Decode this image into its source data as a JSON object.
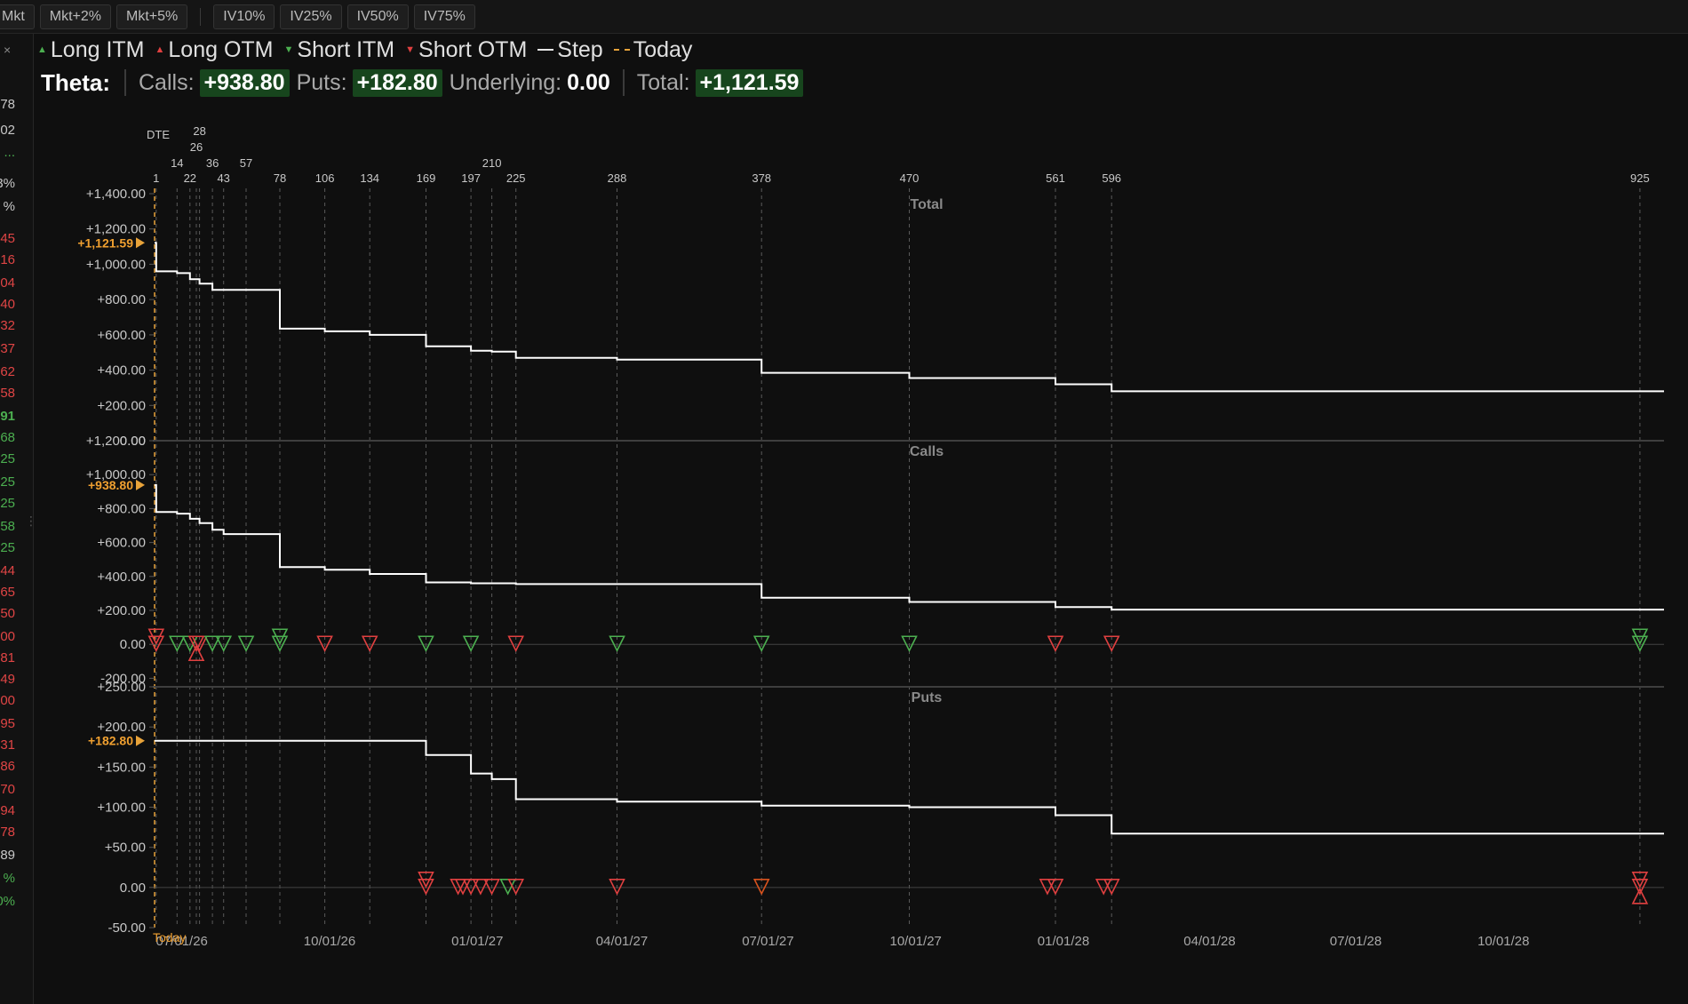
{
  "toolbar": {
    "buttons_left": [
      "Mkt",
      "Mkt+2%",
      "Mkt+5%"
    ],
    "buttons_right": [
      "IV10%",
      "IV25%",
      "IV50%",
      "IV75%"
    ]
  },
  "sidebar": {
    "close_glyph": "×",
    "handle_glyph": "⋮",
    "values": [
      {
        "text": "78",
        "color": "#c8c8c8"
      },
      {
        "text": "02",
        "color": "#c8c8c8"
      },
      {
        "text": "...",
        "color": "#4caf50"
      },
      {
        "text": "3%",
        "color": "#c8c8c8"
      },
      {
        "text": "%",
        "color": "#c8c8c8"
      },
      {
        "text": "45",
        "color": "#e04545"
      },
      {
        "text": "16",
        "color": "#e04545"
      },
      {
        "text": "04",
        "color": "#e04545"
      },
      {
        "text": "40",
        "color": "#e04545"
      },
      {
        "text": "32",
        "color": "#e04545"
      },
      {
        "text": "37",
        "color": "#e04545"
      },
      {
        "text": "62",
        "color": "#e04545"
      },
      {
        "text": "58",
        "color": "#e04545"
      },
      {
        "text": "91",
        "color": "#4caf50",
        "bold": true
      },
      {
        "text": "68",
        "color": "#4caf50"
      },
      {
        "text": "25",
        "color": "#4caf50"
      },
      {
        "text": "25",
        "color": "#4caf50"
      },
      {
        "text": "25",
        "color": "#4caf50"
      },
      {
        "text": "58",
        "color": "#4caf50"
      },
      {
        "text": "25",
        "color": "#4caf50"
      },
      {
        "text": "44",
        "color": "#e04545"
      },
      {
        "text": "65",
        "color": "#e04545"
      },
      {
        "text": "50",
        "color": "#e04545"
      },
      {
        "text": "00",
        "color": "#e04545"
      },
      {
        "text": "81",
        "color": "#e04545"
      },
      {
        "text": "49",
        "color": "#e04545"
      },
      {
        "text": "00",
        "color": "#e04545"
      },
      {
        "text": "95",
        "color": "#e04545"
      },
      {
        "text": "31",
        "color": "#e04545"
      },
      {
        "text": "86",
        "color": "#e04545"
      },
      {
        "text": "70",
        "color": "#e04545"
      },
      {
        "text": "94",
        "color": "#e04545"
      },
      {
        "text": "78",
        "color": "#e04545"
      },
      {
        "text": "89",
        "color": "#c8c8c8"
      },
      {
        "text": "%",
        "color": "#4caf50"
      },
      {
        "text": "0%",
        "color": "#4caf50"
      }
    ]
  },
  "legend": {
    "items": [
      {
        "label": "Long ITM",
        "mark": "▲",
        "color": "#4caf50"
      },
      {
        "label": "Long OTM",
        "mark": "▲",
        "color": "#e04040"
      },
      {
        "label": "Short ITM",
        "mark": "▼",
        "color": "#4caf50"
      },
      {
        "label": "Short OTM",
        "mark": "▼",
        "color": "#e04040"
      },
      {
        "label": "Step",
        "mark": "line",
        "color": "#e6e6e6"
      },
      {
        "label": "Today",
        "mark": "dash",
        "color": "#e8a33a"
      }
    ]
  },
  "summary": {
    "title": "Theta:",
    "calls_label": "Calls:",
    "calls_value": "+938.80",
    "puts_label": "Puts:",
    "puts_value": "+182.80",
    "underlying_label": "Underlying:",
    "underlying_value": "0.00",
    "total_label": "Total:",
    "total_value": "+1,121.59"
  },
  "colors": {
    "background": "#0f0f0f",
    "line": "#ffffff",
    "today": "#e8a33a",
    "grid": "#5a5a5a",
    "itm": "#4caf50",
    "otm": "#e04040",
    "otm_orange": "#d9531e",
    "value_badge": "#17451d"
  },
  "chart_data": {
    "type": "line",
    "dte_header": "DTE",
    "today_label": "Today",
    "dte_ticks": [
      1,
      14,
      22,
      26,
      28,
      36,
      43,
      57,
      78,
      106,
      134,
      169,
      197,
      210,
      225,
      288,
      378,
      470,
      561,
      596,
      925
    ],
    "date_ticks": [
      "07/01/26",
      "10/01/26",
      "01/01/27",
      "04/01/27",
      "07/01/27",
      "10/01/27",
      "01/01/28",
      "04/01/28",
      "07/01/28",
      "10/01/28"
    ],
    "date_tick_dte": [
      17,
      109,
      201,
      291,
      382,
      474,
      566,
      657,
      748,
      840
    ],
    "panels": [
      {
        "title": "Total",
        "now_value_label": "+1,121.59",
        "yticks": [
          "+1,400.00",
          "+1,200.00",
          "+1,000.00",
          "+800.00",
          "+600.00",
          "+400.00",
          "+200.00",
          "0.00"
        ],
        "ylim": [
          0,
          1400
        ],
        "steps": [
          {
            "dte": 0,
            "value": 1121.59
          },
          {
            "dte": 1,
            "value": 960
          },
          {
            "dte": 14,
            "value": 950
          },
          {
            "dte": 22,
            "value": 915
          },
          {
            "dte": 28,
            "value": 890
          },
          {
            "dte": 36,
            "value": 855
          },
          {
            "dte": 78,
            "value": 635
          },
          {
            "dte": 106,
            "value": 620
          },
          {
            "dte": 134,
            "value": 600
          },
          {
            "dte": 169,
            "value": 535
          },
          {
            "dte": 197,
            "value": 510
          },
          {
            "dte": 210,
            "value": 505
          },
          {
            "dte": 225,
            "value": 470
          },
          {
            "dte": 288,
            "value": 460
          },
          {
            "dte": 378,
            "value": 385
          },
          {
            "dte": 470,
            "value": 355
          },
          {
            "dte": 561,
            "value": 320
          },
          {
            "dte": 596,
            "value": 280
          },
          {
            "dte": 940,
            "value": 280
          }
        ],
        "markers": []
      },
      {
        "title": "Calls",
        "now_value_label": "+938.80",
        "yticks": [
          "+1,200.00",
          "+1,000.00",
          "+800.00",
          "+600.00",
          "+400.00",
          "+200.00",
          "0.00",
          "-200.00"
        ],
        "ylim": [
          -250,
          1200
        ],
        "steps": [
          {
            "dte": 0,
            "value": 938.8
          },
          {
            "dte": 1,
            "value": 780
          },
          {
            "dte": 14,
            "value": 770
          },
          {
            "dte": 22,
            "value": 740
          },
          {
            "dte": 28,
            "value": 715
          },
          {
            "dte": 36,
            "value": 675
          },
          {
            "dte": 43,
            "value": 650
          },
          {
            "dte": 78,
            "value": 455
          },
          {
            "dte": 106,
            "value": 440
          },
          {
            "dte": 134,
            "value": 415
          },
          {
            "dte": 169,
            "value": 365
          },
          {
            "dte": 197,
            "value": 360
          },
          {
            "dte": 225,
            "value": 355
          },
          {
            "dte": 378,
            "value": 275
          },
          {
            "dte": 470,
            "value": 250
          },
          {
            "dte": 561,
            "value": 220
          },
          {
            "dte": 596,
            "value": 205
          },
          {
            "dte": 940,
            "value": 205
          }
        ],
        "markers": [
          {
            "dte": 1,
            "kind": "short",
            "itm": false
          },
          {
            "dte": 1,
            "kind": "short",
            "itm": false,
            "offset": 1
          },
          {
            "dte": 14,
            "kind": "short",
            "itm": true
          },
          {
            "dte": 22,
            "kind": "short",
            "itm": true
          },
          {
            "dte": 26,
            "kind": "short",
            "itm": false
          },
          {
            "dte": 26,
            "kind": "long",
            "itm": false
          },
          {
            "dte": 28,
            "kind": "short",
            "itm": false
          },
          {
            "dte": 36,
            "kind": "short",
            "itm": true
          },
          {
            "dte": 43,
            "kind": "short",
            "itm": true
          },
          {
            "dte": 57,
            "kind": "short",
            "itm": true
          },
          {
            "dte": 78,
            "kind": "short",
            "itm": true
          },
          {
            "dte": 78,
            "kind": "short",
            "itm": true,
            "offset": 1
          },
          {
            "dte": 106,
            "kind": "short",
            "itm": false
          },
          {
            "dte": 134,
            "kind": "short",
            "itm": false
          },
          {
            "dte": 169,
            "kind": "short",
            "itm": true
          },
          {
            "dte": 197,
            "kind": "short",
            "itm": true
          },
          {
            "dte": 225,
            "kind": "short",
            "itm": false
          },
          {
            "dte": 288,
            "kind": "short",
            "itm": true
          },
          {
            "dte": 378,
            "kind": "short",
            "itm": true
          },
          {
            "dte": 470,
            "kind": "short",
            "itm": true
          },
          {
            "dte": 561,
            "kind": "short",
            "itm": false
          },
          {
            "dte": 596,
            "kind": "short",
            "itm": false
          },
          {
            "dte": 925,
            "kind": "short",
            "itm": true
          },
          {
            "dte": 925,
            "kind": "short",
            "itm": true,
            "offset": 1
          }
        ]
      },
      {
        "title": "Puts",
        "now_value_label": "+182.80",
        "yticks": [
          "+250.00",
          "+200.00",
          "+150.00",
          "+100.00",
          "+50.00",
          "0.00",
          "-50.00"
        ],
        "ylim": [
          -50,
          250
        ],
        "steps": [
          {
            "dte": 0,
            "value": 182.8
          },
          {
            "dte": 169,
            "value": 165
          },
          {
            "dte": 197,
            "value": 142
          },
          {
            "dte": 210,
            "value": 135
          },
          {
            "dte": 225,
            "value": 110
          },
          {
            "dte": 288,
            "value": 107
          },
          {
            "dte": 378,
            "value": 102
          },
          {
            "dte": 470,
            "value": 100
          },
          {
            "dte": 561,
            "value": 90
          },
          {
            "dte": 596,
            "value": 67
          },
          {
            "dte": 940,
            "value": 67
          }
        ],
        "markers": [
          {
            "dte": 169,
            "kind": "short",
            "itm": false
          },
          {
            "dte": 169,
            "kind": "short",
            "itm": false,
            "offset": 1
          },
          {
            "dte": 189,
            "kind": "short",
            "itm": false
          },
          {
            "dte": 192,
            "kind": "short",
            "itm": false
          },
          {
            "dte": 197,
            "kind": "short",
            "itm": false
          },
          {
            "dte": 203,
            "kind": "short",
            "itm": false
          },
          {
            "dte": 210,
            "kind": "short",
            "itm": false
          },
          {
            "dte": 220,
            "kind": "short",
            "itm": true
          },
          {
            "dte": 225,
            "kind": "short",
            "itm": false
          },
          {
            "dte": 288,
            "kind": "short",
            "itm": false
          },
          {
            "dte": 378,
            "kind": "short",
            "itm": false,
            "orange": true
          },
          {
            "dte": 556,
            "kind": "short",
            "itm": false
          },
          {
            "dte": 561,
            "kind": "short",
            "itm": false
          },
          {
            "dte": 591,
            "kind": "short",
            "itm": false
          },
          {
            "dte": 596,
            "kind": "short",
            "itm": false
          },
          {
            "dte": 925,
            "kind": "short",
            "itm": false
          },
          {
            "dte": 925,
            "kind": "short",
            "itm": false,
            "offset": 1
          },
          {
            "dte": 925,
            "kind": "long",
            "itm": false
          }
        ]
      }
    ]
  }
}
